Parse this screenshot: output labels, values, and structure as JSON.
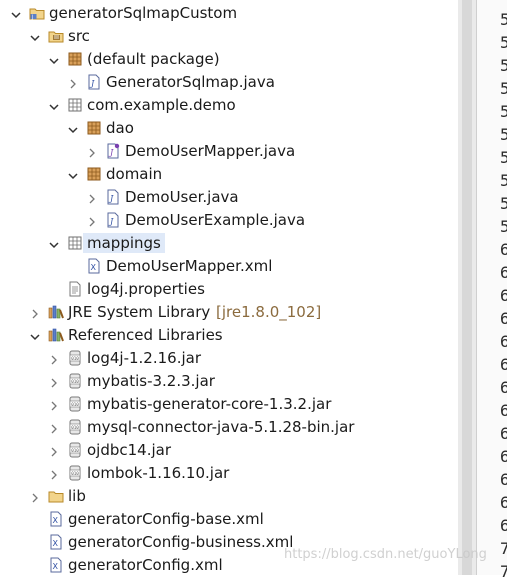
{
  "tree": [
    {
      "label": "generatorSqlmapCustom",
      "icon": "project-icon",
      "twisty": "expanded",
      "indent": 0
    },
    {
      "label": "src",
      "icon": "source-folder-icon",
      "twisty": "expanded",
      "indent": 1
    },
    {
      "label": "(default package)",
      "icon": "package-icon",
      "twisty": "expanded",
      "indent": 2
    },
    {
      "label": "GeneratorSqlmap.java",
      "icon": "java-file-icon",
      "twisty": "collapsed",
      "indent": 3
    },
    {
      "label": "com.example.demo",
      "icon": "empty-package-icon",
      "twisty": "expanded",
      "indent": 2
    },
    {
      "label": "dao",
      "icon": "package-icon",
      "twisty": "expanded",
      "indent": 3
    },
    {
      "label": "DemoUserMapper.java",
      "icon": "java-interface-icon",
      "twisty": "collapsed",
      "indent": 4
    },
    {
      "label": "domain",
      "icon": "package-icon",
      "twisty": "expanded",
      "indent": 3
    },
    {
      "label": "DemoUser.java",
      "icon": "java-file-icon",
      "twisty": "collapsed",
      "indent": 4
    },
    {
      "label": "DemoUserExample.java",
      "icon": "java-file-icon",
      "twisty": "collapsed",
      "indent": 4
    },
    {
      "label": "mappings",
      "icon": "empty-package-icon",
      "twisty": "expanded",
      "indent": 2,
      "selected": true
    },
    {
      "label": "DemoUserMapper.xml",
      "icon": "xml-file-icon",
      "twisty": "none",
      "indent": 3
    },
    {
      "label": "log4j.properties",
      "icon": "properties-file-icon",
      "twisty": "none",
      "indent": 2
    },
    {
      "label": "JRE System Library",
      "decoration": "[jre1.8.0_102]",
      "icon": "library-icon",
      "twisty": "collapsed",
      "indent": 1
    },
    {
      "label": "Referenced Libraries",
      "icon": "library-icon",
      "twisty": "expanded",
      "indent": 1
    },
    {
      "label": "log4j-1.2.16.jar",
      "icon": "jar-icon",
      "twisty": "collapsed",
      "indent": 2
    },
    {
      "label": "mybatis-3.2.3.jar",
      "icon": "jar-icon",
      "twisty": "collapsed",
      "indent": 2
    },
    {
      "label": "mybatis-generator-core-1.3.2.jar",
      "icon": "jar-icon",
      "twisty": "collapsed",
      "indent": 2
    },
    {
      "label": "mysql-connector-java-5.1.28-bin.jar",
      "icon": "jar-icon",
      "twisty": "collapsed",
      "indent": 2
    },
    {
      "label": "ojdbc14.jar",
      "icon": "jar-icon",
      "twisty": "collapsed",
      "indent": 2
    },
    {
      "label": "lombok-1.16.10.jar",
      "icon": "jar-icon",
      "twisty": "collapsed",
      "indent": 2
    },
    {
      "label": "lib",
      "icon": "folder-icon",
      "twisty": "collapsed",
      "indent": 1
    },
    {
      "label": "generatorConfig-base.xml",
      "icon": "xml-file-icon",
      "twisty": "none",
      "indent": 1
    },
    {
      "label": "generatorConfig-business.xml",
      "icon": "xml-file-icon",
      "twisty": "none",
      "indent": 1
    },
    {
      "label": "generatorConfig.xml",
      "icon": "xml-file-icon",
      "twisty": "none",
      "indent": 1
    }
  ],
  "editor_line_digits": [
    "5",
    "5",
    "5",
    "5",
    "5",
    "5",
    "5",
    "5",
    "5",
    "5",
    "6",
    "6",
    "6",
    "6",
    "6",
    "6",
    "6",
    "6",
    "6",
    "6",
    "6",
    "6",
    "6",
    "7",
    "7"
  ],
  "watermark": "https://blog.csdn.net/guoYLong"
}
